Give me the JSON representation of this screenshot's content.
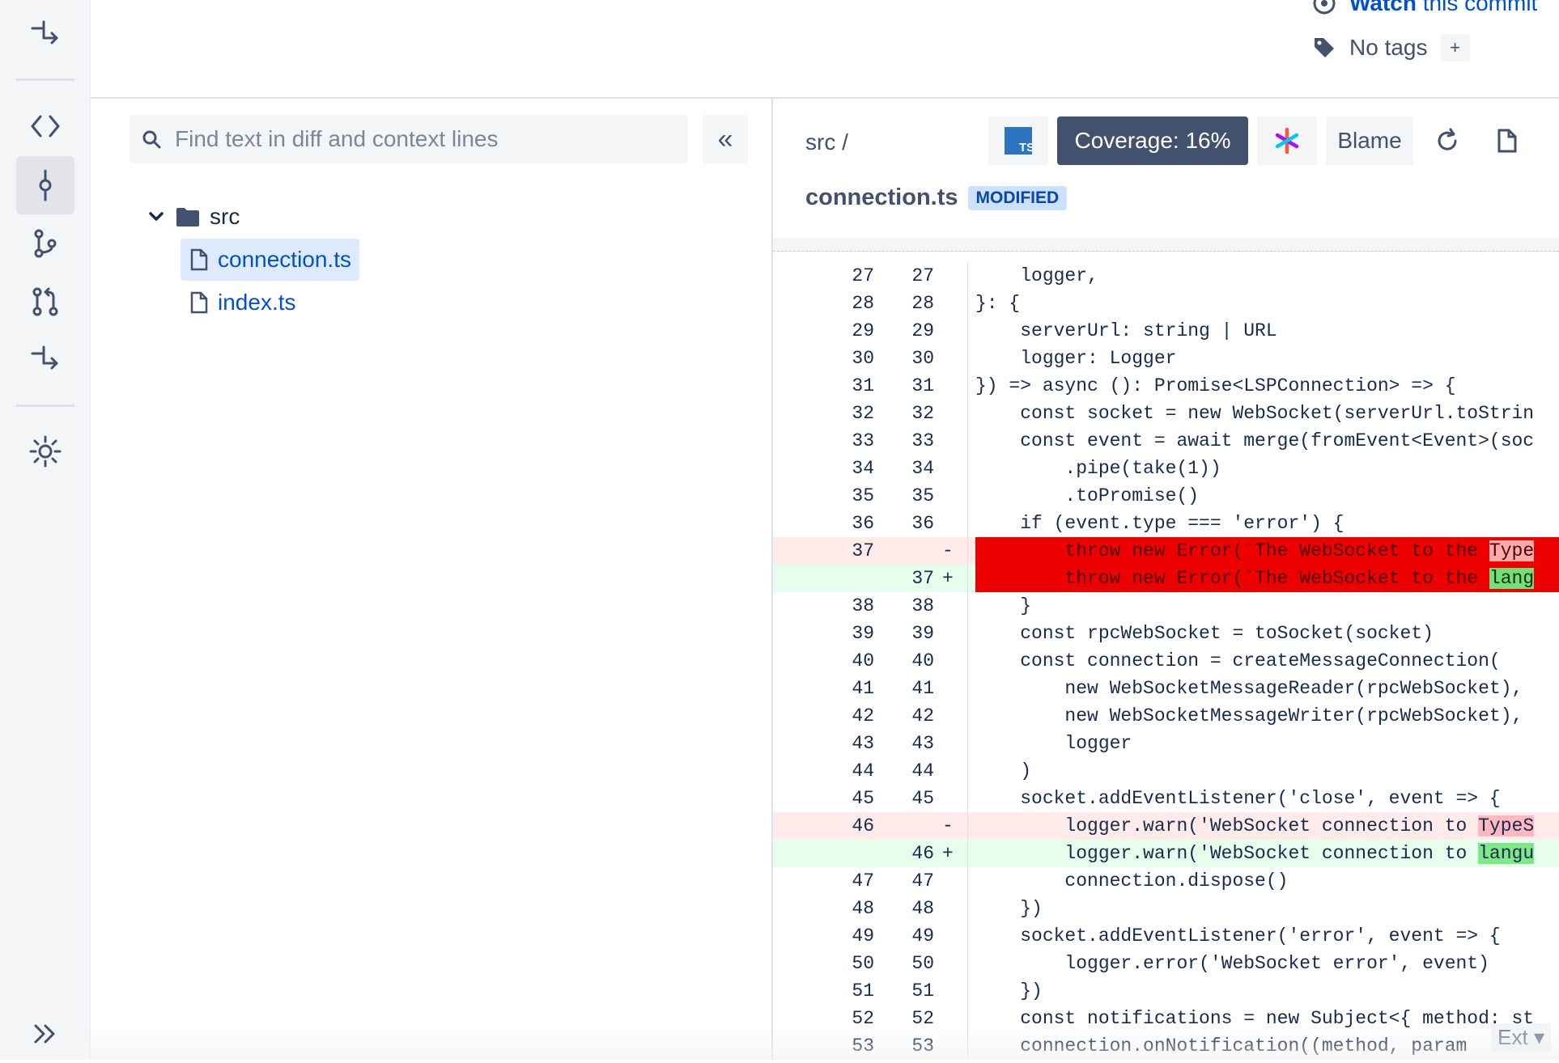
{
  "header": {
    "watch_label_strong": "Watch",
    "watch_label_rest": "this commit",
    "tags_label": "No tags",
    "add_tag_label": "+"
  },
  "tree": {
    "search_placeholder": "Find text in diff and context lines",
    "collapse_label": "«",
    "folder": "src",
    "files": [
      "connection.ts",
      "index.ts"
    ]
  },
  "diff": {
    "breadcrumb": "src /",
    "coverage_label": "Coverage: 16%",
    "blame_label": "Blame",
    "file_name": "connection.ts",
    "status_badge": "MODIFIED",
    "ext_label": "Ext",
    "lines": [
      {
        "old": "27",
        "new": "27",
        "sign": "",
        "text": "    logger,"
      },
      {
        "old": "28",
        "new": "28",
        "sign": "",
        "text": "}: {"
      },
      {
        "old": "29",
        "new": "29",
        "sign": "",
        "text": "    serverUrl: string | URL"
      },
      {
        "old": "30",
        "new": "30",
        "sign": "",
        "text": "    logger: Logger"
      },
      {
        "old": "31",
        "new": "31",
        "sign": "",
        "text": "}) => async (): Promise<LSPConnection> => {"
      },
      {
        "old": "32",
        "new": "32",
        "sign": "",
        "text": "    const socket = new WebSocket(serverUrl.toStrin"
      },
      {
        "old": "33",
        "new": "33",
        "sign": "",
        "text": "    const event = await merge(fromEvent<Event>(soc"
      },
      {
        "old": "34",
        "new": "34",
        "sign": "",
        "text": "        .pipe(take(1))"
      },
      {
        "old": "35",
        "new": "35",
        "sign": "",
        "text": "        .toPromise()"
      },
      {
        "old": "36",
        "new": "36",
        "sign": "",
        "text": "    if (event.type === 'error') {"
      },
      {
        "old": "37",
        "new": "",
        "sign": "-",
        "text": "        throw new Error(`The WebSocket to the ",
        "hl": "Type"
      },
      {
        "old": "",
        "new": "37",
        "sign": "+",
        "text": "        throw new Error(`The WebSocket to the ",
        "hl": "lang"
      },
      {
        "old": "38",
        "new": "38",
        "sign": "",
        "text": "    }"
      },
      {
        "old": "39",
        "new": "39",
        "sign": "",
        "text": "    const rpcWebSocket = toSocket(socket)"
      },
      {
        "old": "40",
        "new": "40",
        "sign": "",
        "text": "    const connection = createMessageConnection("
      },
      {
        "old": "41",
        "new": "41",
        "sign": "",
        "text": "        new WebSocketMessageReader(rpcWebSocket),"
      },
      {
        "old": "42",
        "new": "42",
        "sign": "",
        "text": "        new WebSocketMessageWriter(rpcWebSocket),"
      },
      {
        "old": "43",
        "new": "43",
        "sign": "",
        "text": "        logger"
      },
      {
        "old": "44",
        "new": "44",
        "sign": "",
        "text": "    )"
      },
      {
        "old": "45",
        "new": "45",
        "sign": "",
        "text": "    socket.addEventListener('close', event => {"
      },
      {
        "old": "46",
        "new": "",
        "sign": "-",
        "text": "        logger.warn('WebSocket connection to ",
        "hl": "TypeS"
      },
      {
        "old": "",
        "new": "46",
        "sign": "+",
        "text": "        logger.warn('WebSocket connection to ",
        "hl": "langu"
      },
      {
        "old": "47",
        "new": "47",
        "sign": "",
        "text": "        connection.dispose()"
      },
      {
        "old": "48",
        "new": "48",
        "sign": "",
        "text": "    })"
      },
      {
        "old": "49",
        "new": "49",
        "sign": "",
        "text": "    socket.addEventListener('error', event => {"
      },
      {
        "old": "50",
        "new": "50",
        "sign": "",
        "text": "        logger.error('WebSocket error', event)"
      },
      {
        "old": "51",
        "new": "51",
        "sign": "",
        "text": "    })"
      },
      {
        "old": "52",
        "new": "52",
        "sign": "",
        "text": "    const notifications = new Subject<{ method: st"
      },
      {
        "old": "53",
        "new": "53",
        "sign": "",
        "text": "    connection.onNotification((method, param"
      }
    ]
  },
  "colors": {
    "accent": "#0052cc",
    "coverage_bg": "#42526e",
    "deleted_bg": "#ffebe9",
    "added_bg": "#e6ffec",
    "selection_red": "#ee0000"
  },
  "icons": {
    "rail": [
      "commit-flow-icon",
      "code-icon",
      "commit-icon",
      "branch-icon",
      "pull-request-icon",
      "compare-icon",
      "settings-icon",
      "expand-icon"
    ],
    "toolbar": [
      "typescript-icon",
      "sourcegraph-icon",
      "refresh-icon",
      "file-icon"
    ]
  }
}
